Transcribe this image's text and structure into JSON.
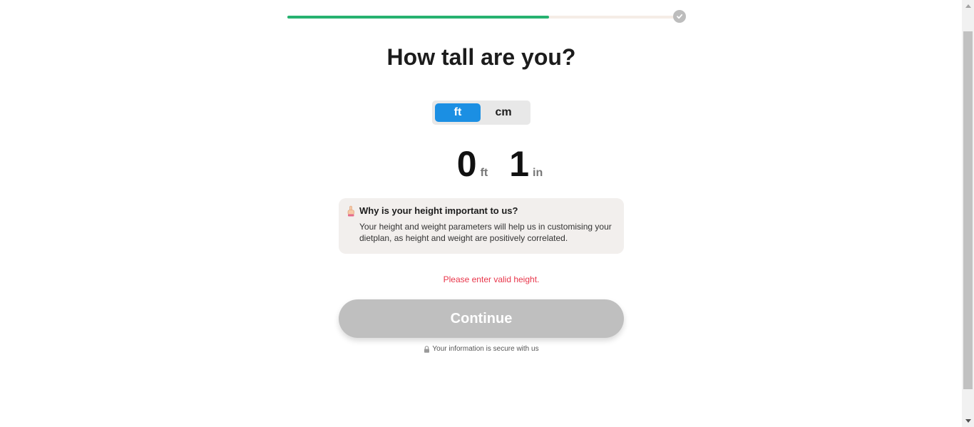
{
  "progress": {
    "fraction": 0.67,
    "fill_color": "#26b270",
    "track_color": "#f5ede6",
    "end_icon": "check-icon"
  },
  "question": {
    "title": "How tall are you?"
  },
  "unit_toggle": {
    "options": [
      "ft",
      "cm"
    ],
    "selected": "ft",
    "active_color": "#1b8fe3"
  },
  "height": {
    "feet_value": "0",
    "feet_unit": "ft",
    "inches_value": "1",
    "inches_unit": "in"
  },
  "info": {
    "icon": "pointing-finger-icon",
    "title": "Why is your height important to us?",
    "body": "Your height and weight parameters will help us in customising your dietplan, as height and weight are positively correlated."
  },
  "error": {
    "message": "Please enter valid height.",
    "color": "#e8354a"
  },
  "continue_button": {
    "label": "Continue",
    "disabled": true
  },
  "secure_note": {
    "icon": "lock-icon",
    "text": "Your information is secure with us"
  }
}
